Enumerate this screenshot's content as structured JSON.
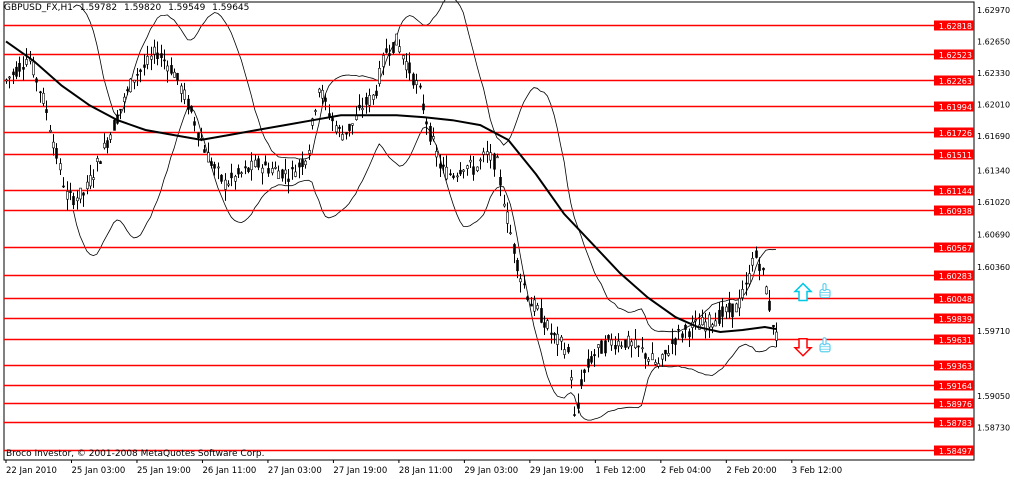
{
  "header": {
    "symbol": "GBPUSD_FX,H1",
    "open": "1.59782",
    "high": "1.59820",
    "low": "1.59549",
    "close": "1.59645"
  },
  "copyright": "Broco Investor, © 2001-2008 MetaQuotes Software Corp.",
  "colors": {
    "background": "#ffffff",
    "level_line": "#ff0000",
    "level_label_bg": "#ff0000",
    "level_label_text": "#ffffff",
    "candles": "#000000",
    "buy_arrow": "#00c8e6",
    "sell_arrow": "#ff0000",
    "hand_icon": "#5fd0f0"
  },
  "icons": [
    "up-arrow-icon",
    "down-arrow-icon",
    "thumbs-up-icon",
    "thumbs-up-icon"
  ],
  "chart_data": {
    "type": "candlestick",
    "timeframe": "H1",
    "ylim": [
      1.584,
      1.6305
    ],
    "grid": false,
    "price_ticks": [
      "1.62970",
      "1.62650",
      "1.62330",
      "1.62010",
      "1.61690",
      "1.61340",
      "1.61020",
      "1.60690",
      "1.60360",
      "1.59710",
      "1.59050",
      "1.58730"
    ],
    "x_tick_labels": [
      "22 Jan 2010",
      "25 Jan 03:00",
      "25 Jan 19:00",
      "26 Jan 11:00",
      "27 Jan 03:00",
      "27 Jan 19:00",
      "28 Jan 11:00",
      "29 Jan 03:00",
      "29 Jan 19:00",
      "1 Feb 12:00",
      "2 Feb 04:00",
      "2 Feb 20:00",
      "3 Feb 12:00"
    ],
    "levels": [
      {
        "label": "1.62818",
        "value": 1.62818
      },
      {
        "label": "1.62523",
        "value": 1.62523
      },
      {
        "label": "1.62263",
        "value": 1.62263
      },
      {
        "label": "1.61994",
        "value": 1.61994
      },
      {
        "label": "1.61726",
        "value": 1.61726
      },
      {
        "label": "1.61511",
        "value": 1.61511
      },
      {
        "label": "1.61144",
        "value": 1.61144
      },
      {
        "label": "1.60938",
        "value": 1.60938
      },
      {
        "label": "1.60567",
        "value": 1.60567
      },
      {
        "label": "1.60283",
        "value": 1.60283
      },
      {
        "label": "1.60048",
        "value": 1.60048
      },
      {
        "label": "1.59839",
        "value": 1.59839
      },
      {
        "label": "1.59631",
        "value": 1.59631
      },
      {
        "label": "1.59363",
        "value": 1.59363
      },
      {
        "label": "1.59164",
        "value": 1.59164
      },
      {
        "label": "1.58976",
        "value": 1.58976
      },
      {
        "label": "1.58783",
        "value": 1.58783
      },
      {
        "label": "1.58497",
        "value": 1.58497
      }
    ],
    "price_path": [
      [
        0,
        1.6225
      ],
      [
        4,
        1.625
      ],
      [
        7,
        1.62
      ],
      [
        9,
        1.615
      ],
      [
        11,
        1.6105
      ],
      [
        14,
        1.611
      ],
      [
        17,
        1.615
      ],
      [
        20,
        1.619
      ],
      [
        23,
        1.623
      ],
      [
        25,
        1.624
      ],
      [
        27,
        1.6255
      ],
      [
        30,
        1.6235
      ],
      [
        33,
        1.6195
      ],
      [
        36,
        1.615
      ],
      [
        39,
        1.612
      ],
      [
        42,
        1.613
      ],
      [
        45,
        1.614
      ],
      [
        48,
        1.6135
      ],
      [
        51,
        1.613
      ],
      [
        54,
        1.615
      ],
      [
        56,
        1.622
      ],
      [
        58,
        1.619
      ],
      [
        60,
        1.617
      ],
      [
        62,
        1.618
      ],
      [
        64,
        1.62
      ],
      [
        66,
        1.621
      ],
      [
        68,
        1.6255
      ],
      [
        70,
        1.6265
      ],
      [
        72,
        1.624
      ],
      [
        74,
        1.6215
      ],
      [
        76,
        1.617
      ],
      [
        78,
        1.6135
      ],
      [
        80,
        1.613
      ],
      [
        82,
        1.614
      ],
      [
        84,
        1.6135
      ],
      [
        86,
        1.615
      ],
      [
        88,
        1.614
      ],
      [
        90,
        1.608
      ],
      [
        92,
        1.603
      ],
      [
        94,
        1.6
      ],
      [
        96,
        1.5985
      ],
      [
        98,
        1.5965
      ],
      [
        100,
        1.5955
      ],
      [
        101,
        1.5945
      ],
      [
        102,
        1.587
      ],
      [
        103,
        1.592
      ],
      [
        105,
        1.5945
      ],
      [
        108,
        1.596
      ],
      [
        111,
        1.596
      ],
      [
        114,
        1.595
      ],
      [
        117,
        1.5935
      ],
      [
        120,
        1.5965
      ],
      [
        123,
        1.5975
      ],
      [
        126,
        1.598
      ],
      [
        129,
        1.599
      ],
      [
        131,
        1.5995
      ],
      [
        133,
        1.602
      ],
      [
        134,
        1.605
      ],
      [
        135,
        1.604
      ],
      [
        136,
        1.602
      ],
      [
        137,
        1.599
      ],
      [
        138,
        1.5965
      ]
    ],
    "ma_path": [
      [
        0,
        1.6265
      ],
      [
        5,
        1.6245
      ],
      [
        10,
        1.622
      ],
      [
        15,
        1.62
      ],
      [
        20,
        1.6185
      ],
      [
        25,
        1.6175
      ],
      [
        30,
        1.617
      ],
      [
        35,
        1.6165
      ],
      [
        40,
        1.617
      ],
      [
        45,
        1.6175
      ],
      [
        50,
        1.618
      ],
      [
        55,
        1.6185
      ],
      [
        60,
        1.619
      ],
      [
        65,
        1.619
      ],
      [
        70,
        1.619
      ],
      [
        75,
        1.6188
      ],
      [
        80,
        1.6185
      ],
      [
        85,
        1.618
      ],
      [
        90,
        1.6165
      ],
      [
        95,
        1.613
      ],
      [
        100,
        1.609
      ],
      [
        105,
        1.606
      ],
      [
        110,
        1.603
      ],
      [
        115,
        1.6005
      ],
      [
        120,
        1.5985
      ],
      [
        124,
        1.5975
      ],
      [
        128,
        1.597
      ],
      [
        132,
        1.5972
      ],
      [
        136,
        1.5975
      ],
      [
        138,
        1.5973
      ]
    ],
    "signals": [
      {
        "type": "buy",
        "value": 1.601
      },
      {
        "type": "sell",
        "value": 1.5955
      }
    ]
  }
}
